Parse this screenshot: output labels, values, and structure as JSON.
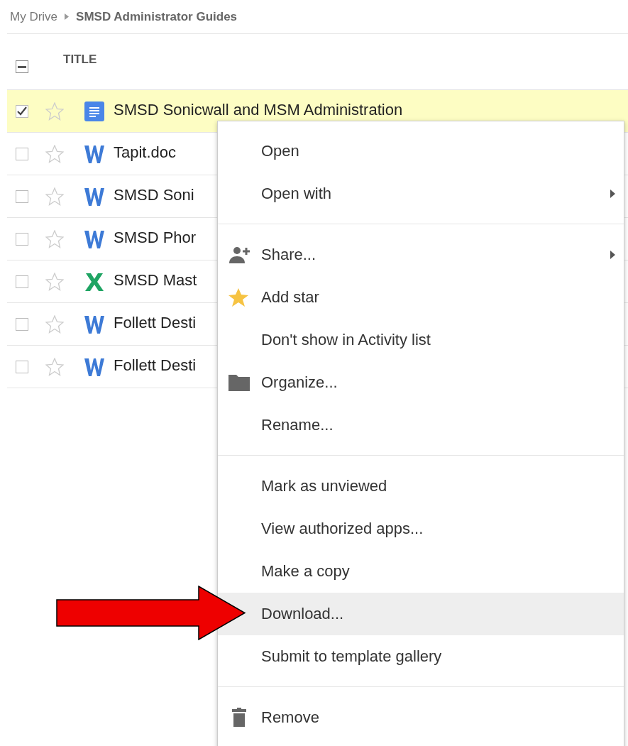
{
  "breadcrumb": {
    "root": "My Drive",
    "current": "SMSD Administrator Guides"
  },
  "table": {
    "header": {
      "indeterminate": true,
      "title": "TITLE"
    },
    "rows": [
      {
        "name": "SMSD Sonicwall and MSM Administration",
        "kind": "gdoc",
        "checked": true,
        "starred": false,
        "selected": true
      },
      {
        "name": "Tapit.doc",
        "kind": "word",
        "checked": false,
        "starred": false,
        "selected": false
      },
      {
        "name": "SMSD Soni",
        "kind": "word",
        "checked": false,
        "starred": false,
        "selected": false
      },
      {
        "name": "SMSD Phor",
        "kind": "word",
        "checked": false,
        "starred": false,
        "selected": false
      },
      {
        "name": "SMSD Mast",
        "kind": "excel",
        "checked": false,
        "starred": false,
        "selected": false
      },
      {
        "name": "Follett Desti",
        "kind": "word",
        "checked": false,
        "starred": false,
        "selected": false
      },
      {
        "name": "Follett Desti",
        "kind": "word",
        "checked": false,
        "starred": false,
        "selected": false
      }
    ]
  },
  "context_menu": {
    "items": [
      {
        "kind": "item",
        "label": "Open",
        "submenu": false,
        "highlighted": false
      },
      {
        "kind": "item",
        "label": "Open with",
        "submenu": true,
        "highlighted": false
      },
      {
        "kind": "separator"
      },
      {
        "kind": "share",
        "label": "Share...",
        "submenu": true,
        "highlighted": false
      },
      {
        "kind": "star",
        "label": "Add star",
        "submenu": false,
        "highlighted": false
      },
      {
        "kind": "item",
        "label": "Don't show in Activity list",
        "submenu": false,
        "highlighted": false
      },
      {
        "kind": "folder",
        "label": "Organize...",
        "submenu": false,
        "highlighted": false
      },
      {
        "kind": "item",
        "label": "Rename...",
        "submenu": false,
        "highlighted": false
      },
      {
        "kind": "separator"
      },
      {
        "kind": "item",
        "label": "Mark as unviewed",
        "submenu": false,
        "highlighted": false
      },
      {
        "kind": "item",
        "label": "View authorized apps...",
        "submenu": false,
        "highlighted": false
      },
      {
        "kind": "item",
        "label": "Make a copy",
        "submenu": false,
        "highlighted": false
      },
      {
        "kind": "item",
        "label": "Download...",
        "submenu": false,
        "highlighted": true
      },
      {
        "kind": "item",
        "label": "Submit to template gallery",
        "submenu": false,
        "highlighted": false
      },
      {
        "kind": "separator"
      },
      {
        "kind": "trash",
        "label": "Remove",
        "submenu": false,
        "highlighted": false
      }
    ]
  },
  "callout": {
    "kind": "arrow"
  }
}
